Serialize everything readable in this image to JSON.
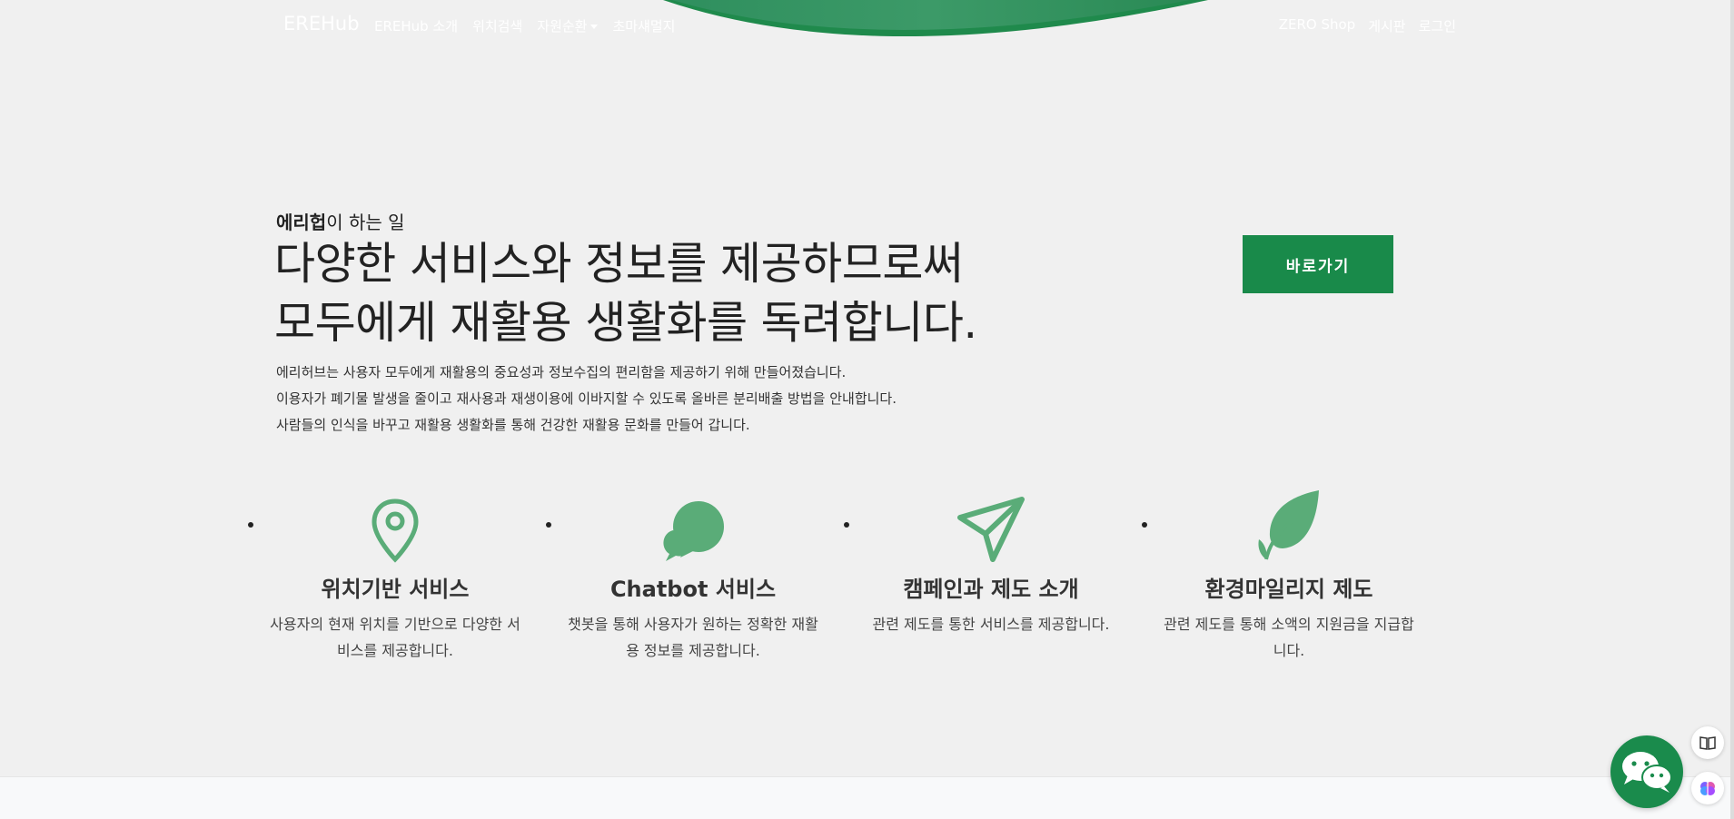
{
  "navbar": {
    "brand": "EREHub",
    "left_links": [
      "EREHub 소개",
      "위치검색",
      "자원순환",
      "초마섀멀지"
    ],
    "right_links": [
      "ZERO Shop",
      "게시판",
      "로그인"
    ]
  },
  "intro": {
    "kicker_bold": "에리헙",
    "kicker_rest": "이 하는 일",
    "title_line1": "다양한 서비스와 정보를 제공하므로써",
    "title_line2": "모두에게 재활용 생활화를 독려합니다.",
    "desc": [
      "에리허브는 사용자 모두에게 재활용의 중요성과 정보수집의 편리함을 제공하기 위해 만들어졌습니다.",
      "이용자가 폐기물 발생을 줄이고 재사용과 재생이용에 이바지할 수 있도록 올바른 분리배출 방법을 안내합니다.",
      "사람들의 인식을 바꾸고 재활용 생활화를 통해 건강한 재활용 문화를 만들어 갑니다."
    ],
    "button_label": "바로가기"
  },
  "features": [
    {
      "icon": "location-pin-icon",
      "title": "위치기반 서비스",
      "desc": "사용자의 현재 위치를 기반으로 다양한 서비스를 제공합니다."
    },
    {
      "icon": "chat-bubbles-icon",
      "title": "Chatbot 서비스",
      "desc": "챗봇을 통해 사용자가 원하는 정확한 재활용 정보를 제공합니다."
    },
    {
      "icon": "paper-plane-icon",
      "title": "캠페인과 제도 소개",
      "desc": "관련 제도를 통한 서비스를 제공합니다."
    },
    {
      "icon": "leaf-icon",
      "title": "환경마일리지 제도",
      "desc": "관련 제도를 통해 소액의 지원금을 지급합니다."
    }
  ],
  "colors": {
    "accent": "#198a4a",
    "icon": "#5aac78",
    "background": "#f0f0f0"
  }
}
